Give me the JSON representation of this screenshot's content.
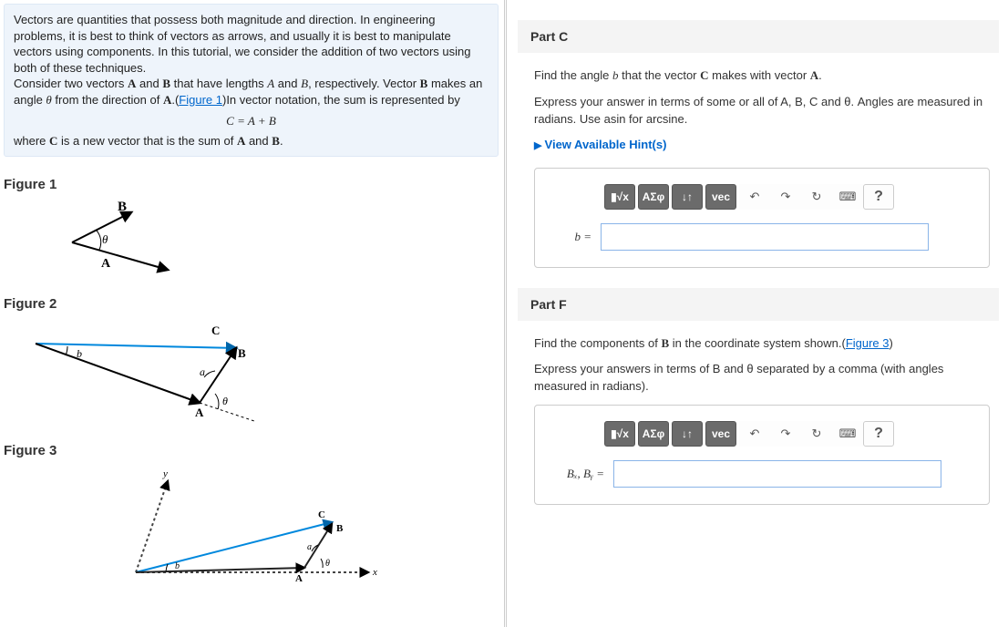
{
  "intro": {
    "p1": "Vectors are quantities that possess both magnitude and direction. In engineering problems, it is best to think of vectors as arrows, and usually it is best to manipulate vectors using components. In this tutorial, we consider the addition of two vectors using both of these techniques.",
    "p2a": "Consider two vectors ",
    "p2b": " and ",
    "p2c": " that have lengths ",
    "p2d": " and ",
    "p2e": ", respectively. Vector ",
    "p2f": " makes an angle ",
    "p2g": " from the direction of ",
    "p2h": ".(",
    "fig1_link": "Figure 1",
    "p2i": ")In vector notation, the sum is represented by",
    "equation": "C = A + B",
    "p3a": "where ",
    "p3b": " is a new vector that is the sum of ",
    "p3c": " and ",
    "p3d": ".",
    "A": "A",
    "B": "B",
    "C": "C",
    "Ai": "A",
    "Bi": "B",
    "theta": "θ"
  },
  "figures": {
    "f1": "Figure 1",
    "f2": "Figure 2",
    "f3": "Figure 3",
    "labels": {
      "A": "A",
      "B": "B",
      "C": "C",
      "theta": "θ",
      "b": "b",
      "a": "a",
      "x": "x",
      "y": "y"
    }
  },
  "partC": {
    "header": "Part C",
    "q1a": "Find the angle ",
    "q1b": " that the vector ",
    "q1c": " makes with vector ",
    "q1d": ".",
    "b": "b",
    "C": "C",
    "A": "A",
    "instr": "Express your answer in terms of some or all of A, B, C and θ. Angles are measured in radians. Use asin for arcsine.",
    "hints": "View Available Hint(s)",
    "label": "b ="
  },
  "partF": {
    "header": "Part F",
    "q1a": "Find the components of ",
    "q1b": " in the coordinate system shown.(",
    "fig3_link": "Figure 3",
    "q1c": ")",
    "B": "B",
    "instr": "Express your answers in terms of B and θ separated by a comma (with angles measured in radians).",
    "label": "Bₓ, Bᵧ ="
  },
  "toolbar": {
    "templates": "▮√x",
    "greek": "ΑΣφ",
    "scripts": "↓↑",
    "vec": "vec",
    "undo": "↶",
    "redo": "↷",
    "reset": "↻",
    "keyboard": "⌨",
    "help": "?"
  }
}
